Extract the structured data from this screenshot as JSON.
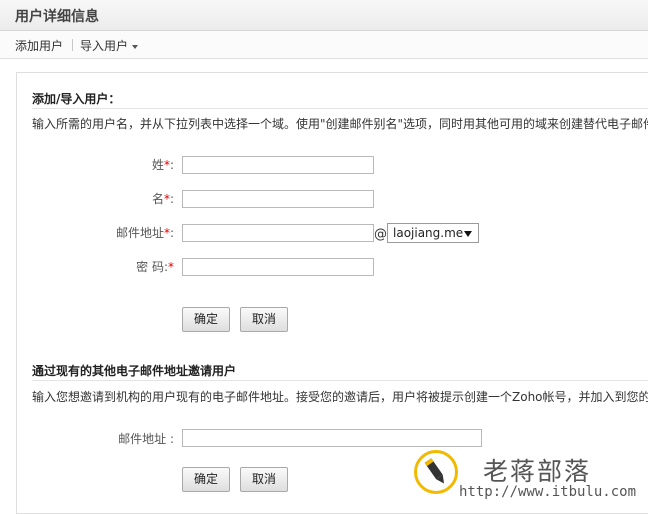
{
  "header": {
    "title": "用户详细信息"
  },
  "toolbar": {
    "add_user": "添加用户",
    "import_user": "导入用户"
  },
  "add_section": {
    "title": "添加/导入用户：",
    "description": "输入所需的用户名，并从下拉列表中选择一个域。使用\"创建邮件别名\"选项，同时用其他可用的域来创建替代电子邮件",
    "fields": {
      "last_name": {
        "label": "姓",
        "value": ""
      },
      "first_name": {
        "label": "名",
        "value": ""
      },
      "email": {
        "label": "邮件地址",
        "value": "",
        "at": "@",
        "domain": "laojiang.me"
      },
      "password": {
        "label": "密 码:",
        "value": ""
      }
    },
    "required_mark": "*",
    "colon": ":",
    "confirm_label": "确定",
    "cancel_label": "取消"
  },
  "invite_section": {
    "title": "通过现有的其他电子邮件地址邀请用户",
    "description": "输入您想邀请到机构的用户现有的电子邮件地址。接受您的邀请后，用户将被提示创建一个Zoho帐号，并加入到您的",
    "email_label": "邮件地址 :",
    "email_value": "",
    "confirm_label": "确定",
    "cancel_label": "取消"
  },
  "watermark": {
    "brand": "老蒋部落",
    "url": "http://www.itbulu.com"
  },
  "colors": {
    "required": "#dd0000",
    "watermark_ring": "#f1b900"
  }
}
